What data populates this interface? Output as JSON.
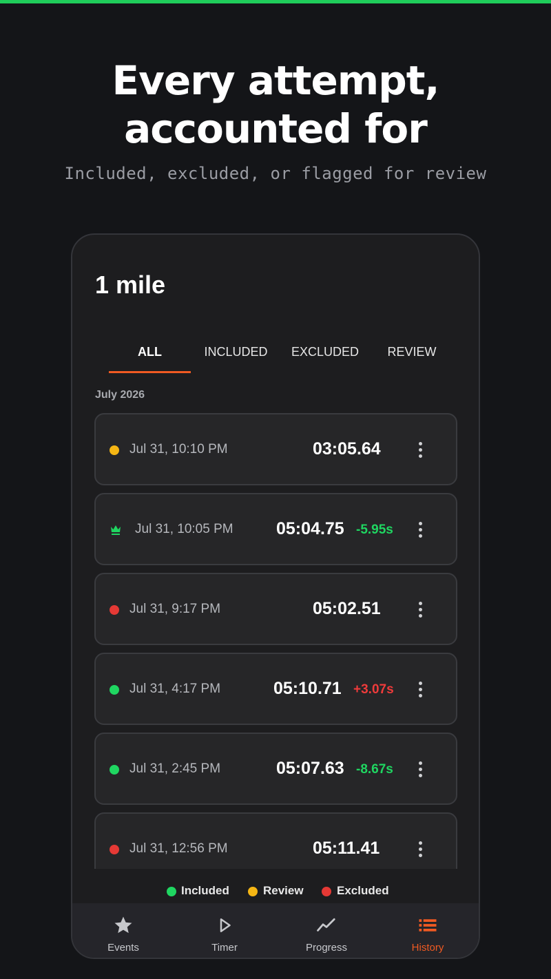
{
  "hero": {
    "title_line1": "Every attempt,",
    "title_line2": "accounted for",
    "subtitle": "Included, excluded, or flagged for review"
  },
  "screen": {
    "title": "1 mile",
    "tabs": [
      {
        "label": "ALL",
        "active": true
      },
      {
        "label": "INCLUDED",
        "active": false
      },
      {
        "label": "EXCLUDED",
        "active": false
      },
      {
        "label": "REVIEW",
        "active": false
      }
    ],
    "month_header": "July 2026",
    "attempts": [
      {
        "status": "review",
        "date": "Jul 31, 10:10 PM",
        "time": "03:05.64",
        "delta": ""
      },
      {
        "status": "best",
        "date": "Jul 31, 10:05 PM",
        "time": "05:04.75",
        "delta": "-5.95s",
        "delta_type": "better"
      },
      {
        "status": "excluded",
        "date": "Jul 31, 9:17 PM",
        "time": "05:02.51",
        "delta": ""
      },
      {
        "status": "included",
        "date": "Jul 31, 4:17 PM",
        "time": "05:10.71",
        "delta": "+3.07s",
        "delta_type": "worse"
      },
      {
        "status": "included",
        "date": "Jul 31, 2:45 PM",
        "time": "05:07.63",
        "delta": "-8.67s",
        "delta_type": "better"
      },
      {
        "status": "excluded",
        "date": "Jul 31, 12:56 PM",
        "time": "05:11.41",
        "delta": ""
      }
    ],
    "legend": [
      {
        "label": "Included",
        "status": "included"
      },
      {
        "label": "Review",
        "status": "review"
      },
      {
        "label": "Excluded",
        "status": "excluded"
      }
    ]
  },
  "nav": [
    {
      "label": "Events",
      "icon": "star-icon",
      "active": false
    },
    {
      "label": "Timer",
      "icon": "play-icon",
      "active": false
    },
    {
      "label": "Progress",
      "icon": "trend-line-icon",
      "active": false
    },
    {
      "label": "History",
      "icon": "list-icon",
      "active": true
    }
  ],
  "colors": {
    "included": "#1fd661",
    "review": "#f5b614",
    "excluded": "#e53935",
    "better": "#1fd661",
    "worse": "#ef3b3b",
    "accent": "#f05a22"
  }
}
